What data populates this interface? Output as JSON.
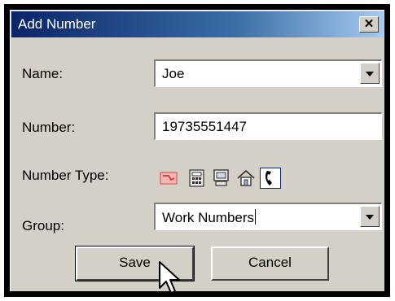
{
  "window": {
    "title": "Add Number",
    "close_label": "✕"
  },
  "form": {
    "name_label": "Name:",
    "name_value": "Joe",
    "number_label": "Number:",
    "number_value": "19735551447",
    "number_type_label": "Number Type:",
    "number_type_icons": [
      "pager-icon",
      "fax-icon",
      "computer-icon",
      "home-icon",
      "phone-icon"
    ],
    "number_type_selected": "phone-icon",
    "group_label": "Group:",
    "group_value": "Work Numbers"
  },
  "buttons": {
    "save_label": "Save",
    "cancel_label": "Cancel"
  },
  "colors": {
    "titlebar_start": "#0a246a",
    "titlebar_end": "#a6caf0",
    "dialog_bg": "#d4d0c8",
    "pager_red": "#d94040"
  }
}
